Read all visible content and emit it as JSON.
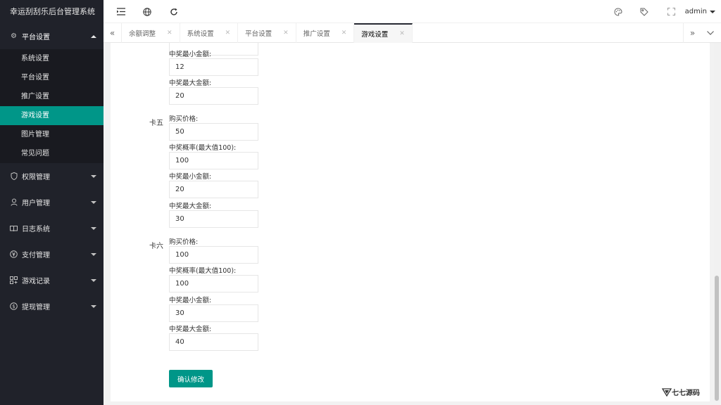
{
  "app": {
    "title": "幸运刮刮乐后台管理系统"
  },
  "header": {
    "user": "admin"
  },
  "sidebar": {
    "groups": [
      {
        "label": "平台设置",
        "icon": "gear-icon",
        "open": true,
        "items": [
          {
            "label": "系统设置"
          },
          {
            "label": "平台设置"
          },
          {
            "label": "推广设置"
          },
          {
            "label": "游戏设置",
            "active": true
          },
          {
            "label": "图片管理"
          },
          {
            "label": "常见问题"
          }
        ]
      },
      {
        "label": "权限管理",
        "icon": "shield-icon"
      },
      {
        "label": "用户管理",
        "icon": "user-icon"
      },
      {
        "label": "日志系统",
        "icon": "book-icon"
      },
      {
        "label": "支付管理",
        "icon": "yen-icon"
      },
      {
        "label": "游戏记录",
        "icon": "game-icon"
      },
      {
        "label": "提现管理",
        "icon": "money-icon"
      }
    ]
  },
  "tabs": [
    {
      "label": "余额调整"
    },
    {
      "label": "系统设置"
    },
    {
      "label": "平台设置"
    },
    {
      "label": "推广设置"
    },
    {
      "label": "游戏设置",
      "active": true
    }
  ],
  "form": {
    "prev": {
      "min_label": "中奖最小金额:",
      "min_value": "12",
      "max_label": "中奖最大金额:",
      "max_value": "20"
    },
    "card5": {
      "label": "卡五",
      "price_label": "购买价格:",
      "price_value": "50",
      "rate_label": "中奖概率(最大值100):",
      "rate_value": "100",
      "min_label": "中奖最小金额:",
      "min_value": "20",
      "max_label": "中奖最大金额:",
      "max_value": "30"
    },
    "card6": {
      "label": "卡六",
      "price_label": "购买价格:",
      "price_value": "100",
      "rate_label": "中奖概率(最大值100):",
      "rate_value": "100",
      "min_label": "中奖最小金额:",
      "min_value": "30",
      "max_label": "中奖最大金额:",
      "max_value": "40"
    },
    "submit_label": "确认修改"
  },
  "watermark": {
    "text": "七七源码"
  }
}
